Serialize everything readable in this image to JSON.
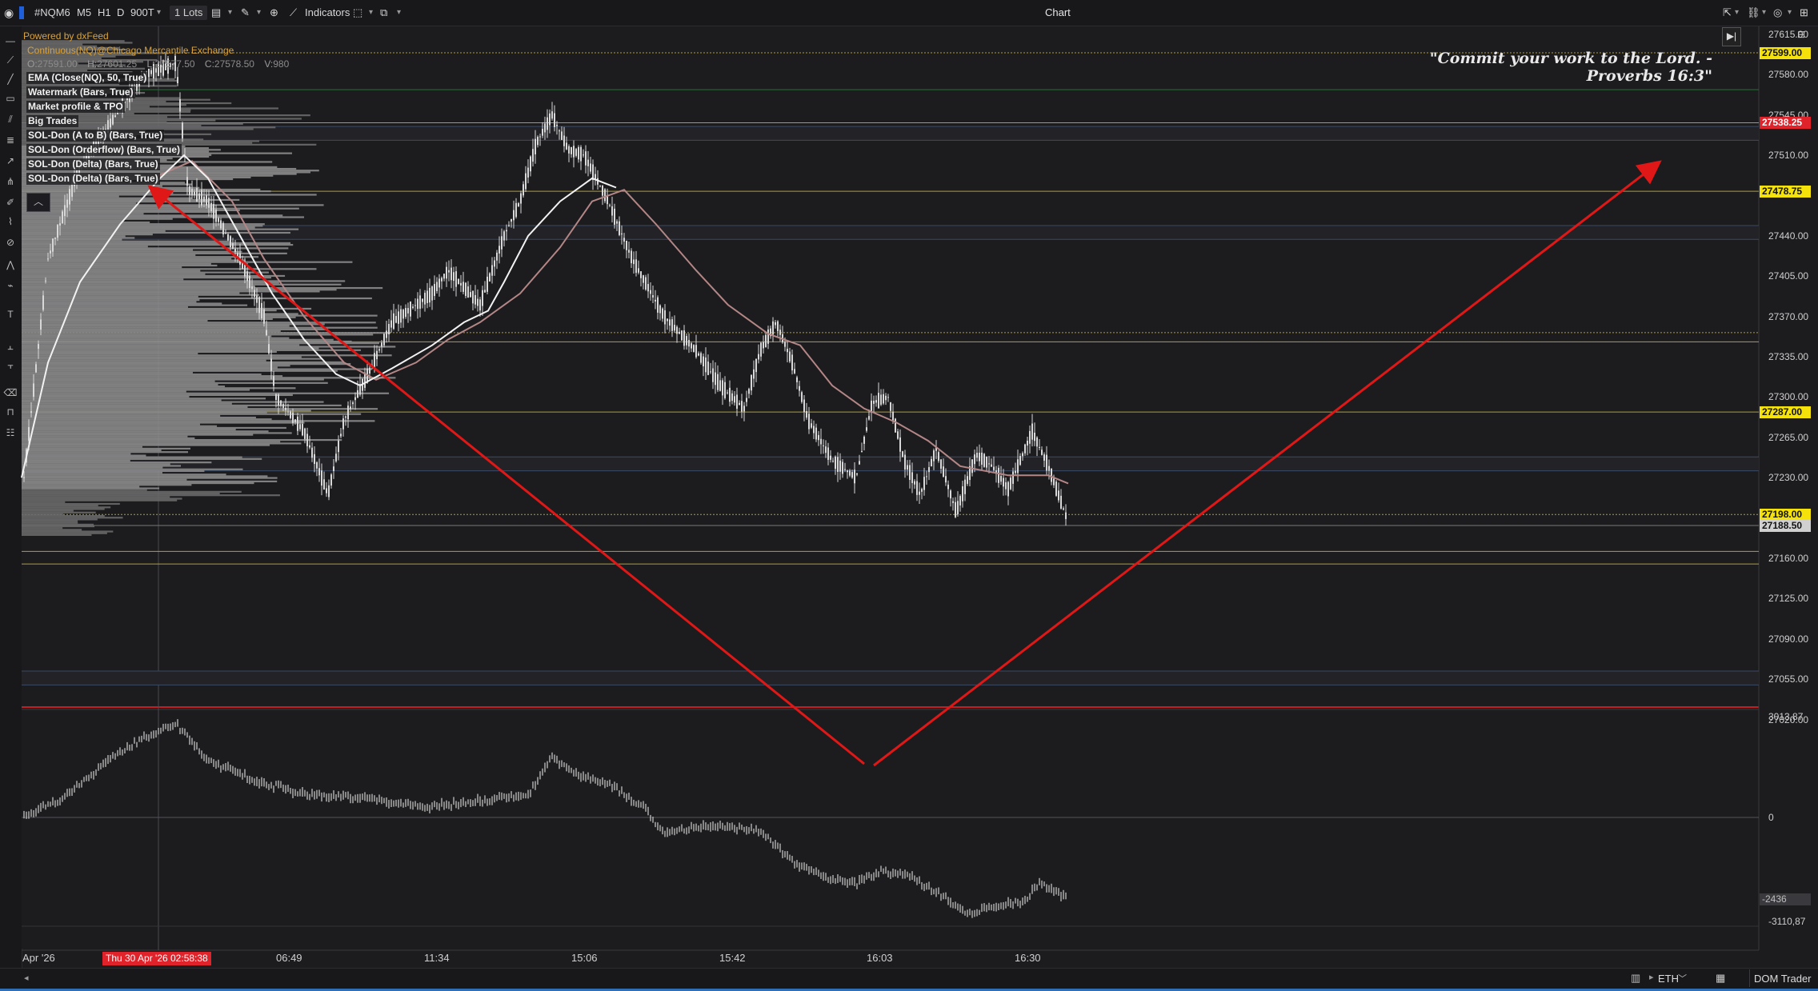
{
  "toolbar": {
    "symbol": "#NQM6",
    "timeframes": [
      "M5",
      "H1",
      "D",
      "900T"
    ],
    "lots": "1 Lots",
    "indicators_label": "Indicators",
    "window_title": "Chart"
  },
  "chart_header": {
    "powered_by": "Powered by dxFeed",
    "instrument": "Continuous(NQ)@Chicago Mercantile Exchange",
    "ohlc": {
      "o_label": "O:",
      "o": "27591.00",
      "h_label": "H:",
      "h": "27601.25",
      "l_label": "L:",
      "l": "27577.50",
      "c_label": "C:",
      "c": "27578.50",
      "v_label": "V:",
      "v": "980"
    },
    "indicators": [
      "EMA (Close(NQ), 50, True)",
      "Watermark (Bars, True)",
      "Market profile & TPO",
      "Big Trades",
      "SOL-Don (A to B) (Bars, True)",
      "SOL-Don (Orderflow) (Bars, True)",
      "SOL-Don (Delta) (Bars, True)",
      "SOL-Don (Delta) (Bars, True)"
    ]
  },
  "watermark_text": "\"Commit your work to the Lord. - Proverbs 16:3\"",
  "price_axis": {
    "labels": [
      "27615.00",
      "27580.00",
      "27545.00",
      "27510.00",
      "27440.00",
      "27405.00",
      "27370.00",
      "27335.00",
      "27300.00",
      "27265.00",
      "27230.00",
      "27160.00",
      "27125.00",
      "27090.00",
      "27055.00",
      "27020.00"
    ],
    "badges": [
      {
        "text": "27599.00",
        "bg": "#f5e20a",
        "fg": "#111111"
      },
      {
        "text": "27538.25",
        "bg": "#e0222a",
        "fg": "#ffffff"
      },
      {
        "text": "27478.75",
        "bg": "#f5e20a",
        "fg": "#111111"
      },
      {
        "text": "27287.00",
        "bg": "#f5e20a",
        "fg": "#111111"
      },
      {
        "text": "27198.00",
        "bg": "#f5e20a",
        "fg": "#111111"
      },
      {
        "text": "27188.50",
        "bg": "#d0d0d0",
        "fg": "#111111"
      }
    ]
  },
  "delta_axis": {
    "labels": [
      "3013,87",
      "0",
      "-3110,87"
    ],
    "current": "-2436"
  },
  "time_axis": {
    "labels": [
      "Apr '26",
      "06:49",
      "11:34",
      "15:06",
      "15:42",
      "16:03",
      "16:30"
    ],
    "crosshair_label": "Thu 30 Apr '26 02:58:38"
  },
  "status_bar": {
    "session": "ETH",
    "dom_trader": "DOM Trader"
  },
  "colors": {
    "background": "#1c1c1f",
    "candle": "#d8d8d8",
    "ema_fast": "#f2f2f2",
    "ema_slow": "#b48686",
    "arrow": "#e01717",
    "level_yellow": "#c9b53a",
    "level_blue": "#3a4a66"
  }
}
